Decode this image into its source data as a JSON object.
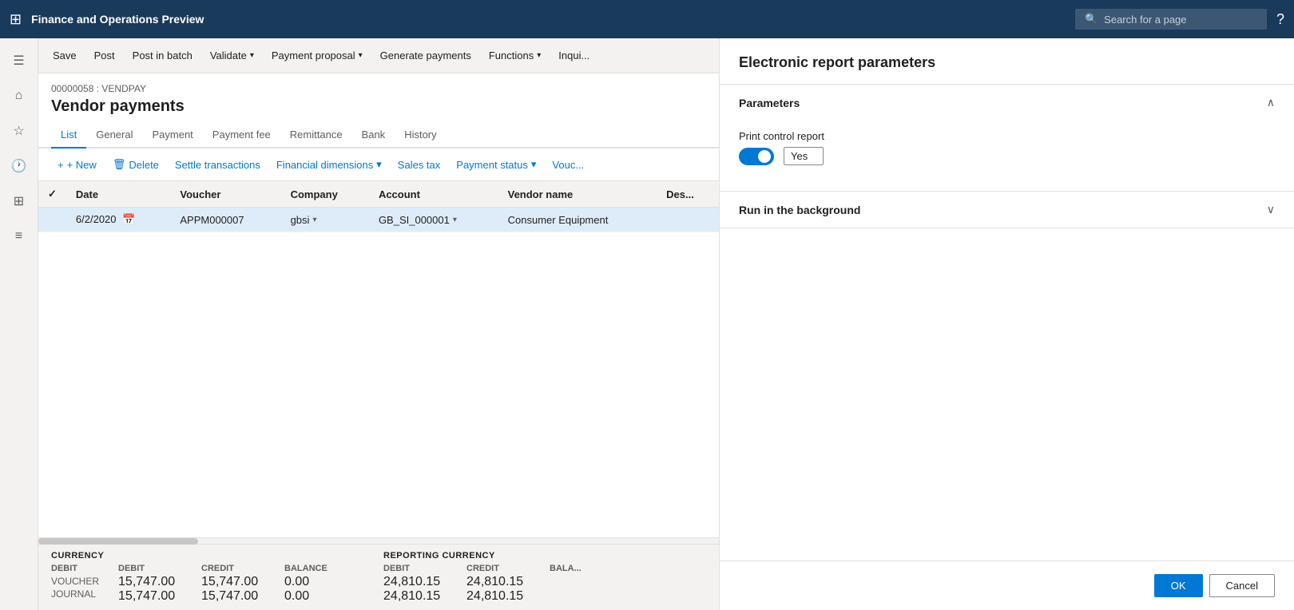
{
  "topbar": {
    "grid_icon": "⊞",
    "title": "Finance and Operations Preview",
    "search_placeholder": "Search for a page",
    "help_icon": "?"
  },
  "sidebar": {
    "items": [
      {
        "icon": "☰",
        "name": "menu-icon"
      },
      {
        "icon": "⌂",
        "name": "home-icon"
      },
      {
        "icon": "★",
        "name": "favorites-icon"
      },
      {
        "icon": "🕐",
        "name": "recent-icon"
      },
      {
        "icon": "⊞",
        "name": "workspaces-icon"
      },
      {
        "icon": "≡",
        "name": "modules-icon"
      }
    ]
  },
  "actionbar": {
    "save_label": "Save",
    "post_label": "Post",
    "post_in_batch_label": "Post in batch",
    "validate_label": "Validate",
    "validate_has_chevron": true,
    "payment_proposal_label": "Payment proposal",
    "payment_proposal_has_chevron": true,
    "generate_payments_label": "Generate payments",
    "functions_label": "Functions",
    "functions_has_chevron": true,
    "inquiries_label": "Inqui..."
  },
  "page": {
    "breadcrumb": "00000058 : VENDPAY",
    "title": "Vendor payments"
  },
  "tabs": [
    {
      "label": "List",
      "active": true
    },
    {
      "label": "General",
      "active": false
    },
    {
      "label": "Payment",
      "active": false
    },
    {
      "label": "Payment fee",
      "active": false
    },
    {
      "label": "Remittance",
      "active": false
    },
    {
      "label": "Bank",
      "active": false
    },
    {
      "label": "History",
      "active": false
    }
  ],
  "toolbar": {
    "new_label": "+ New",
    "delete_label": "Delete",
    "settle_transactions_label": "Settle transactions",
    "financial_dimensions_label": "Financial dimensions",
    "sales_tax_label": "Sales tax",
    "payment_status_label": "Payment status",
    "vouch_label": "Vouc..."
  },
  "table": {
    "columns": [
      "",
      "Date",
      "Voucher",
      "Company",
      "Account",
      "Vendor name",
      "Des..."
    ],
    "rows": [
      {
        "selected": true,
        "date": "6/2/2020",
        "voucher": "APPM000007",
        "company": "gbsi",
        "account": "GB_SI_000001",
        "vendor_name": "Consumer Equipment",
        "description": ""
      }
    ]
  },
  "summary": {
    "currency_label": "CURRENCY",
    "reporting_currency_label": "REPORTING CURRENCY",
    "cols": {
      "debit": "DEBIT",
      "credit": "CREDIT",
      "balance": "BALANCE",
      "bala": "BALA..."
    },
    "rows": [
      {
        "label": "VOUCHER",
        "debit": "15,747.00",
        "credit": "15,747.00",
        "balance": "0.00",
        "rep_debit": "24,810.15",
        "rep_credit": "24,810.15"
      },
      {
        "label": "JOURNAL",
        "debit": "15,747.00",
        "credit": "15,747.00",
        "balance": "0.00",
        "rep_debit": "24,810.15",
        "rep_credit": "24,810.15"
      }
    ]
  },
  "rightpanel": {
    "title": "Electronic report parameters",
    "sections": [
      {
        "id": "parameters",
        "label": "Parameters",
        "expanded": true,
        "fields": [
          {
            "id": "print_control_report",
            "label": "Print control report",
            "toggle_on": true,
            "value": "Yes"
          }
        ]
      },
      {
        "id": "run_in_background",
        "label": "Run in the background",
        "expanded": false
      }
    ],
    "ok_label": "OK",
    "cancel_label": "Cancel"
  }
}
